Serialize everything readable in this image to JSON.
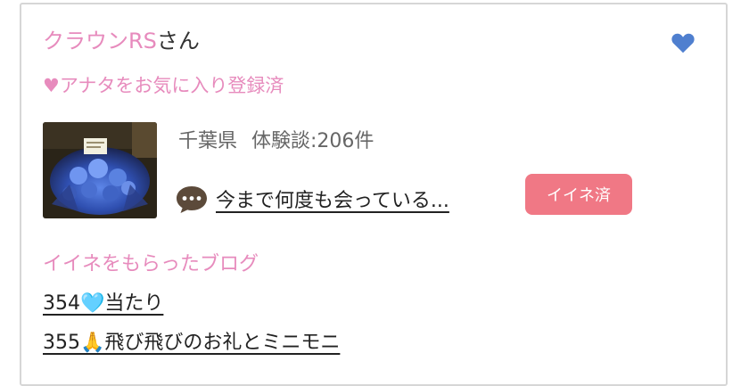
{
  "profile": {
    "name": "クラウンRS",
    "honorific": "さん",
    "favorite_status": "♥アナタをお気に入り登録済",
    "region": "千葉県",
    "reviews_label": "体験談:206件"
  },
  "review": {
    "title": "今まで何度も会っている...",
    "like_button_label": "イイネ済"
  },
  "liked_blogs": {
    "heading": "イイネをもらったブログ",
    "items": [
      {
        "label": "354🩵当たり"
      },
      {
        "label": "355🙏飛び飛びのお礼とミニモニ"
      }
    ]
  },
  "colors": {
    "pink_text": "#e78bbd",
    "heart_blue": "#4f7fcf",
    "button_pink": "#f07885"
  },
  "icons": {
    "favorite": "heart-icon",
    "comment": "speech-bubble-icon"
  }
}
